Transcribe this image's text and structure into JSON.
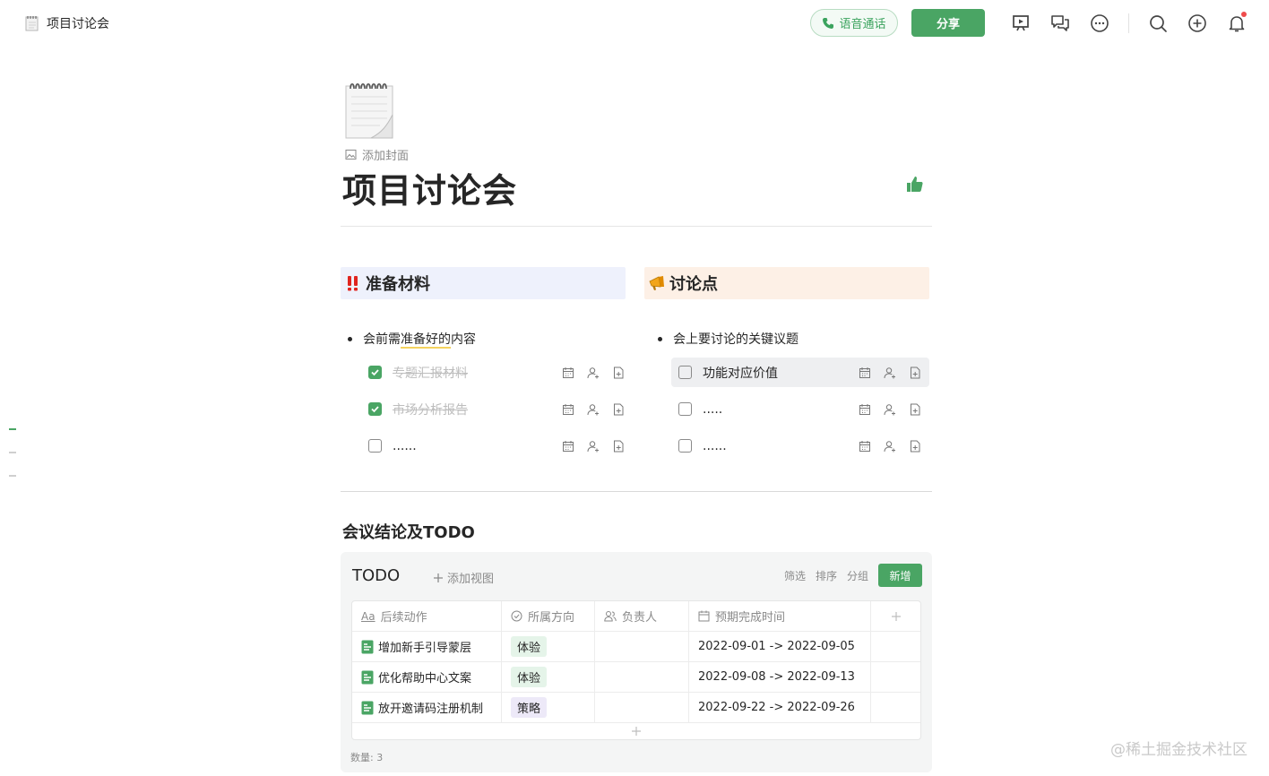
{
  "topbar": {
    "doc_title": "项目讨论会",
    "voice_call_label": "语音通话",
    "share_label": "分享",
    "icons": [
      "present-icon",
      "comment-icon",
      "more-icon",
      "search-icon",
      "add-icon",
      "bell-icon"
    ]
  },
  "doc": {
    "add_cover_label": "添加封面",
    "title": "项目讨论会"
  },
  "left_column": {
    "callout_emoji": "‼️",
    "callout_title": "准备材料",
    "bullet_prefix": "会前需",
    "bullet_highlight": "准备好的",
    "bullet_suffix": "内容",
    "tasks": [
      {
        "label": "专题汇报材料",
        "checked": true
      },
      {
        "label": "市场分析报告",
        "checked": true
      },
      {
        "label": "......",
        "checked": false
      }
    ]
  },
  "right_column": {
    "callout_emoji": "📣",
    "callout_title": "讨论点",
    "bullet": "会上要讨论的关键议题",
    "tasks": [
      {
        "label": "功能对应价值",
        "checked": false
      },
      {
        "label": ".....",
        "checked": false
      },
      {
        "label": "......",
        "checked": false
      }
    ]
  },
  "section": {
    "heading": "会议结论及TODO"
  },
  "database": {
    "title": "TODO",
    "add_view_label": "添加视图",
    "filter_label": "筛选",
    "sort_label": "排序",
    "group_label": "分组",
    "new_label": "新增",
    "columns": [
      "后续动作",
      "所属方向",
      "负责人",
      "预期完成时间"
    ],
    "rows": [
      {
        "action": "增加新手引导蒙层",
        "direction": "体验",
        "owner": "",
        "due": "2022-09-01 -> 2022-09-05"
      },
      {
        "action": "优化帮助中心文案",
        "direction": "体验",
        "owner": "",
        "due": "2022-09-08 -> 2022-09-13"
      },
      {
        "action": "放开邀请码注册机制",
        "direction": "策略",
        "owner": "",
        "due": "2022-09-22 -> 2022-09-26"
      }
    ],
    "count_label": "数量: 3"
  },
  "watermark": "@稀土掘金技术社区",
  "colors": {
    "accent": "#4aa564",
    "callout_blue": "#eef1fc",
    "callout_orange": "#fdf0e6",
    "tag_green": "#e5f4e9",
    "tag_purple": "#ede9f8"
  }
}
